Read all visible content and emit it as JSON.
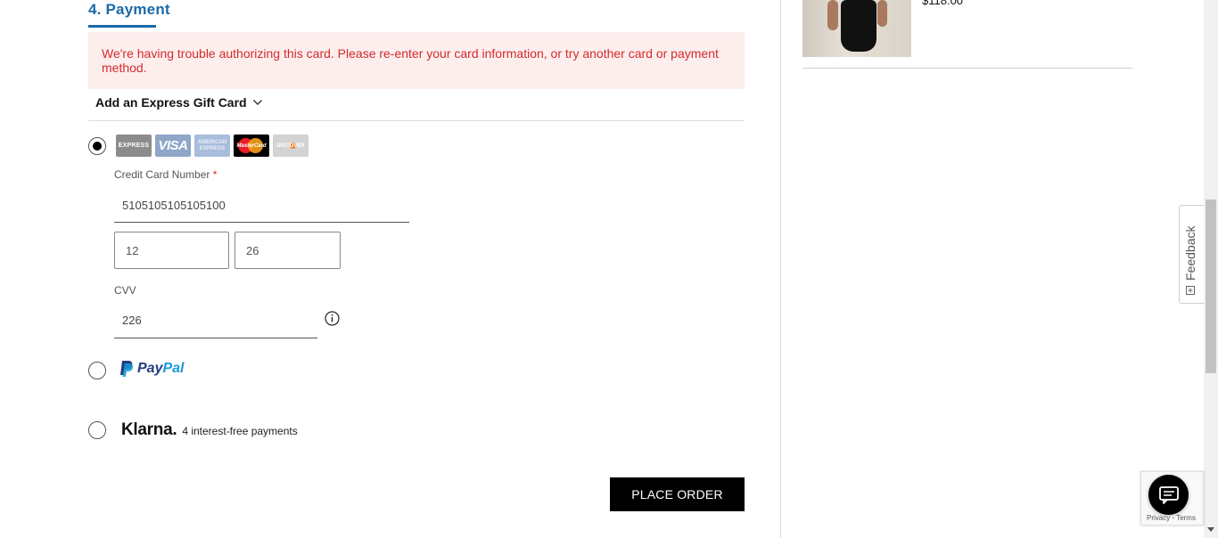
{
  "payment": {
    "section_title": "4. Payment",
    "error_message": "We're having trouble authorizing this card. Please re-enter your card information, or try another card or payment method.",
    "gift_card_label": "Add an Express Gift Card",
    "card_logos": {
      "express": "EXPRESS",
      "visa": "VISA",
      "amex": "AMERICAN EXPRESS",
      "mastercard": "MasterCard",
      "discover": "DISCOVER"
    },
    "credit_card": {
      "number_label": "Credit Card Number",
      "required_mark": "*",
      "number_value": "5105105105105100",
      "exp_month": "12",
      "exp_year": "26",
      "cvv_label": "CVV",
      "cvv_value": "226"
    },
    "paypal": {
      "pay": "Pay",
      "pal": "Pal"
    },
    "klarna": {
      "logo": "Klarna.",
      "subtitle": "4 interest-free payments"
    },
    "place_order_label": "PLACE ORDER",
    "selected_method": "credit_card"
  },
  "order_summary": {
    "item_price": "$118.00"
  },
  "feedback": {
    "label": "Feedback"
  },
  "recaptcha": {
    "text": "Privacy - Terms"
  },
  "colors": {
    "accent": "#1a6aa8",
    "error_text": "#d42a2a",
    "error_bg": "#fdeeee",
    "button_bg": "#000000"
  }
}
